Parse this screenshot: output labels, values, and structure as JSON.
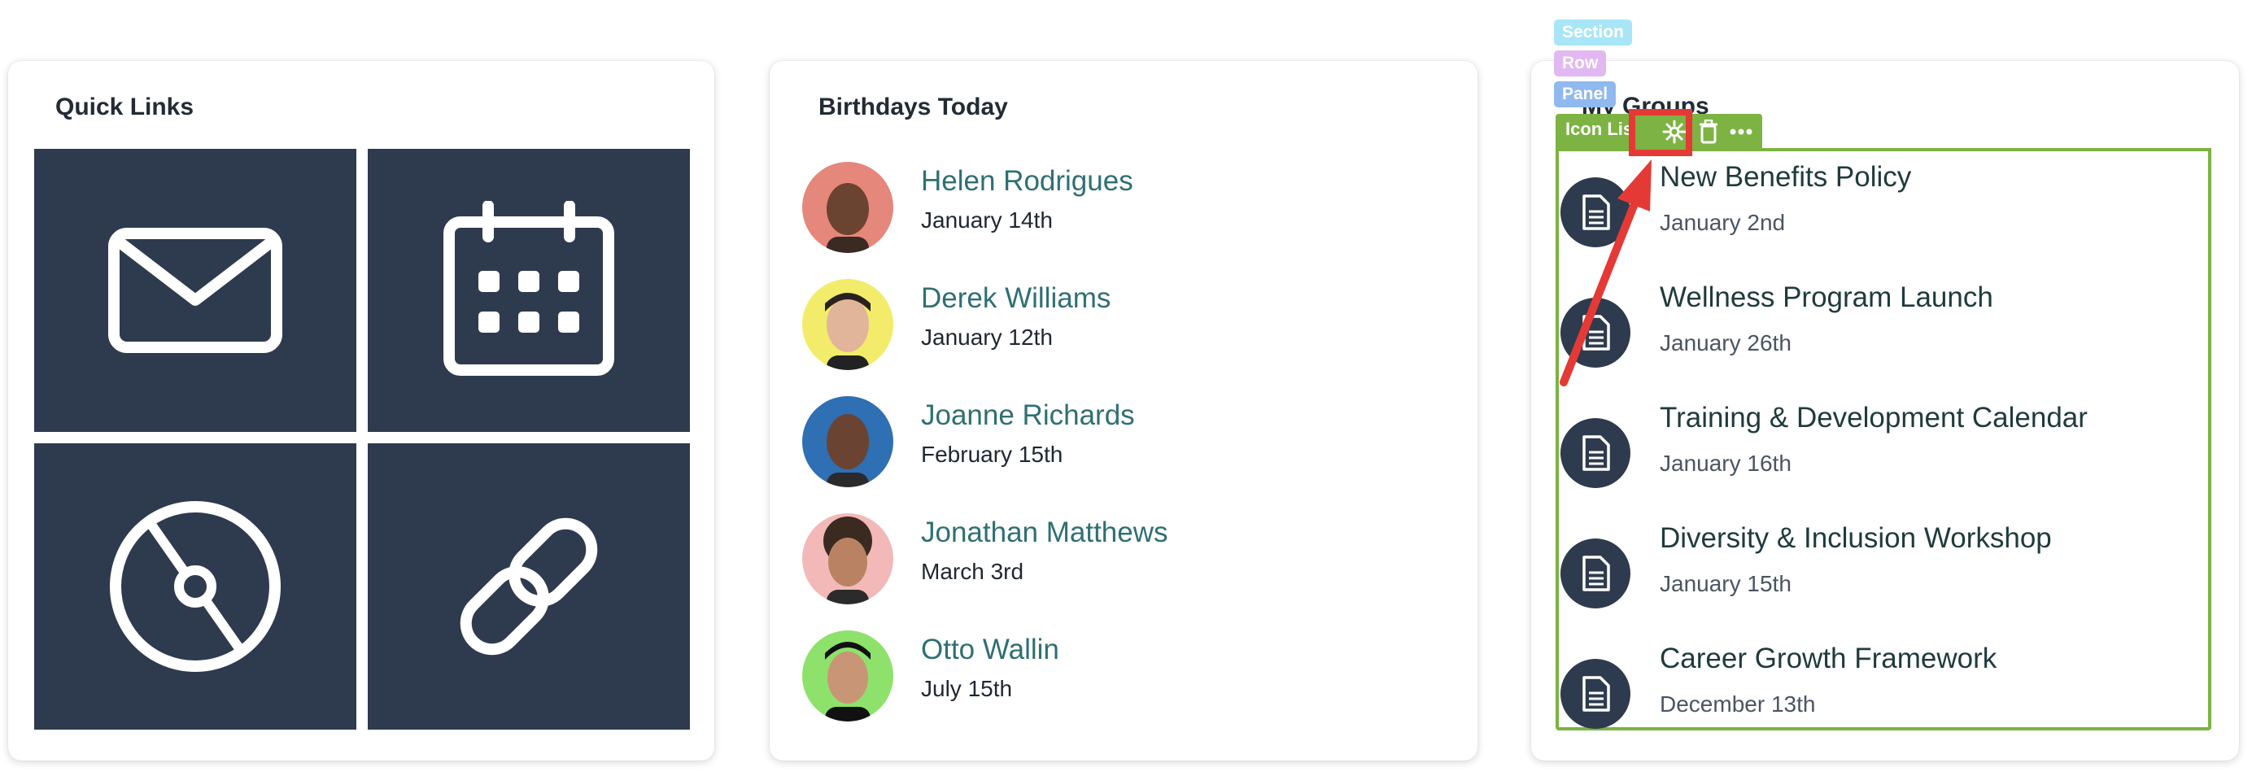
{
  "quick_links": {
    "title": "Quick Links",
    "tiles": [
      {
        "icon": "envelope-icon"
      },
      {
        "icon": "calendar-icon"
      },
      {
        "icon": "disc-icon"
      },
      {
        "icon": "link-icon"
      }
    ],
    "tile_color": "#2e3b4e"
  },
  "birthdays": {
    "title": "Birthdays Today",
    "people": [
      {
        "name": "Helen Rodrigues",
        "date": "January 14th",
        "avatar_bg": "#e5877a"
      },
      {
        "name": "Derek Williams",
        "date": "January 12th",
        "avatar_bg": "#f2ec6a"
      },
      {
        "name": "Joanne Richards",
        "date": "February 15th",
        "avatar_bg": "#2f6fb3"
      },
      {
        "name": "Jonathan Matthews",
        "date": "March 3rd",
        "avatar_bg": "#f3b8b8"
      },
      {
        "name": "Otto Wallin",
        "date": "July 15th",
        "avatar_bg": "#8ee26b"
      }
    ]
  },
  "groups": {
    "title": "My Groups",
    "editor_badges": {
      "section": "Section",
      "row": "Row",
      "panel": "Panel"
    },
    "toolbar_label": "Icon Lis",
    "toolbar_icons": [
      "gear-icon",
      "trash-icon",
      "more-icon"
    ],
    "items": [
      {
        "title": "New Benefits Policy",
        "date": "January 2nd"
      },
      {
        "title": "Wellness Program Launch",
        "date": "January 26th"
      },
      {
        "title": "Training & Development Calendar",
        "date": "January 16th"
      },
      {
        "title": "Diversity & Inclusion Workshop",
        "date": "January 15th"
      },
      {
        "title": "Career Growth Framework",
        "date": "December 13th"
      }
    ],
    "accent_color": "#7cb342",
    "highlight_color": "#e53935"
  }
}
